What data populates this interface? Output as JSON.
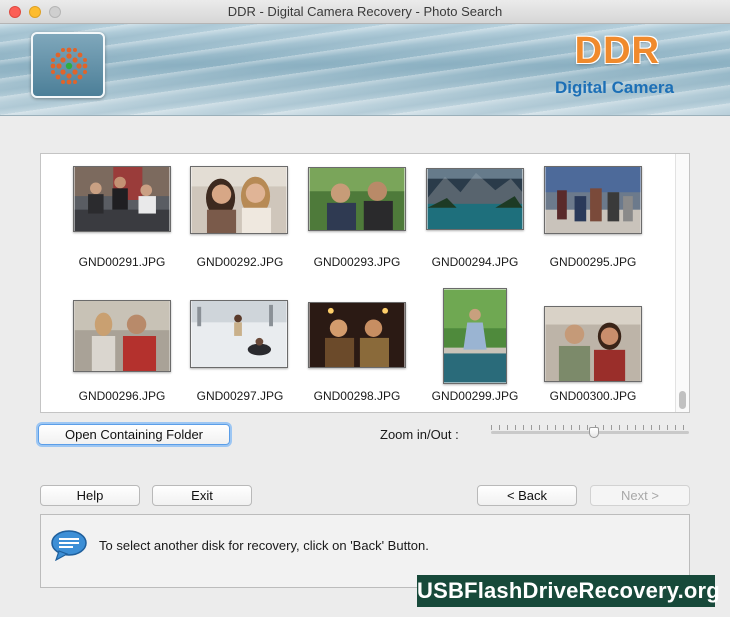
{
  "window": {
    "title": "DDR - Digital Camera Recovery - Photo Search"
  },
  "banner": {
    "brand": "DDR",
    "subtitle": "Digital Camera"
  },
  "photos": [
    {
      "name": "GND00291.JPG"
    },
    {
      "name": "GND00292.JPG"
    },
    {
      "name": "GND00293.JPG"
    },
    {
      "name": "GND00294.JPG"
    },
    {
      "name": "GND00295.JPG"
    },
    {
      "name": "GND00296.JPG"
    },
    {
      "name": "GND00297.JPG"
    },
    {
      "name": "GND00298.JPG"
    },
    {
      "name": "GND00299.JPG"
    },
    {
      "name": "GND00300.JPG"
    }
  ],
  "controls": {
    "open_folder": "Open Containing Folder",
    "zoom_label": "Zoom in/Out :",
    "zoom_level": 0.52
  },
  "buttons": {
    "help": "Help",
    "exit": "Exit",
    "back": "< Back",
    "next": "Next >"
  },
  "info": {
    "message": "To select another disk for recovery, click on 'Back' Button."
  },
  "watermark": "USBFlashDriveRecovery.org"
}
